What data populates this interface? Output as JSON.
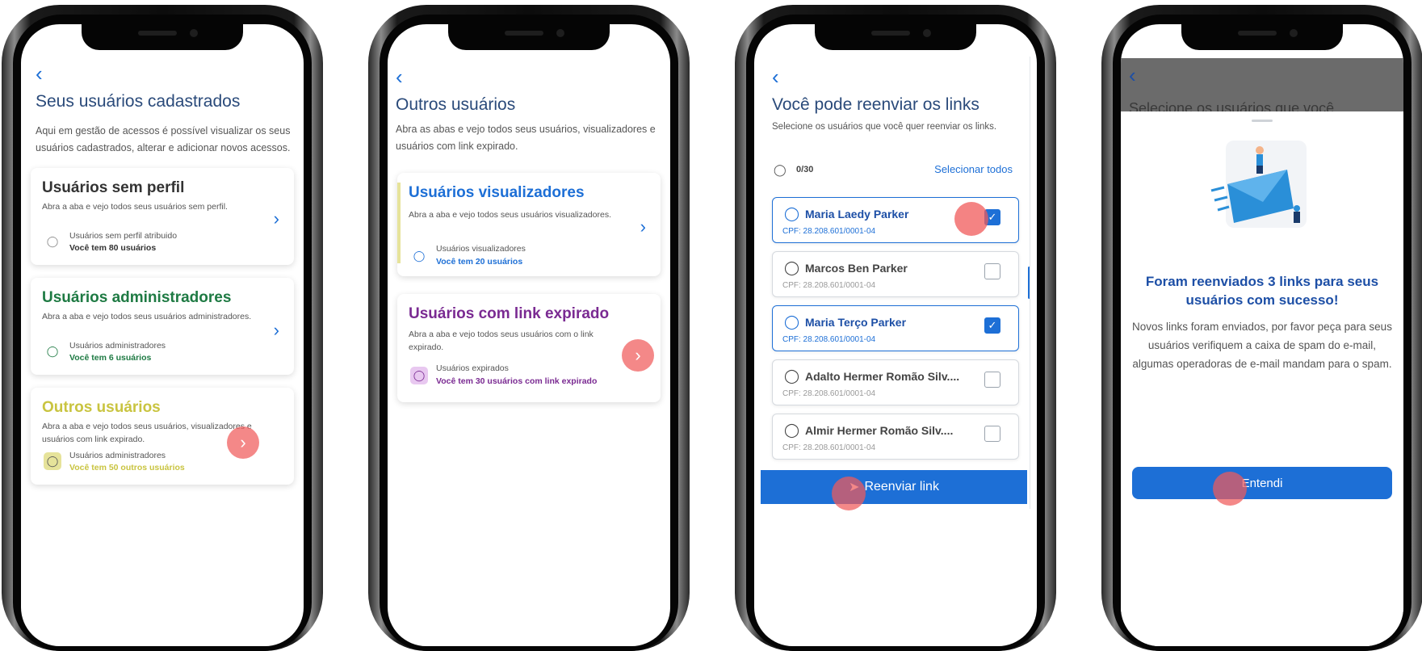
{
  "screens": [
    {
      "back": "‹",
      "title": "Seus usuários cadastrados",
      "description": "Aqui em gestão de acessos  é possível visualizar os seus usuários cadastrados, alterar e adicionar novos acessos.",
      "cards": [
        {
          "title": "Usuários sem perfil",
          "description": "Abra a aba e vejo todos seus usuários sem perfil.",
          "stat_label": "Usuários sem perfil atribuido",
          "stat_value": "Você tem 80 usuários",
          "color": "#333333"
        },
        {
          "title": "Usuários administradores",
          "description": "Abra a aba e vejo todos seus usuários administradores.",
          "stat_label": "Usuários administradores",
          "stat_value": "Você tem 6 usuários",
          "color": "#1e7a43"
        },
        {
          "title": "Outros usuários",
          "description": "Abra a aba e vejo todos seus usuários, visualizadores e usuários com link expirado.",
          "stat_label": "Usuários administradores",
          "stat_value": "Você tem 50 outros usuários",
          "color": "#c9c440"
        }
      ]
    },
    {
      "back": "‹",
      "title": "Outros usuários",
      "description": "Abra as abas e vejo todos seus usuários, visualizadores e usuários com link expirado.",
      "cards": [
        {
          "title": "Usuários visualizadores",
          "description": "Abra a aba e vejo todos seus usuários visualizadores.",
          "stat_label": "Usuários visualizadores",
          "stat_value": "Você tem 20 usuários",
          "color": "#1d6fd6"
        },
        {
          "title": "Usuários com link expirado",
          "description": "Abra a aba e vejo todos seus usuários com o link expirado.",
          "stat_label": "Usuários expirados",
          "stat_value": "Você tem 30 usuários com link expirado",
          "color": "#7a2a92"
        }
      ]
    },
    {
      "back": "‹",
      "title": "Você pode reenviar os links",
      "description": "Selecione os usuários que você quer reenviar os links.",
      "counter": "0/30",
      "select_all": "Selecionar todos",
      "users": [
        {
          "name": "Maria Laedy Parker",
          "cpf": "CPF: 28.208.601/0001-04",
          "selected": true,
          "checked": true
        },
        {
          "name": "Marcos Ben Parker",
          "cpf": "CPF: 28.208.601/0001-04",
          "selected": false,
          "checked": false
        },
        {
          "name": "Maria Terço Parker",
          "cpf": "CPF: 28.208.601/0001-04",
          "selected": true,
          "checked": true
        },
        {
          "name": "Adalto Hermer Romão Silv....",
          "cpf": "CPF: 28.208.601/0001-04",
          "selected": false,
          "checked": false
        },
        {
          "name": "Almir Hermer Romão Silv....",
          "cpf": "CPF: 28.208.601/0001-04",
          "selected": false,
          "checked": false
        }
      ],
      "resend_button": "Reenviar link"
    },
    {
      "back": "‹",
      "background_title": "Selecione os usuários que você",
      "success_title": "Foram reenviados 3 links para seus usuários com sucesso!",
      "success_text": "Novos links foram enviados, por favor peça para seus usuários verifiquem a caixa de spam do e-mail, algumas operadoras de e-mail mandam para o spam.",
      "button": "Entendi"
    }
  ]
}
